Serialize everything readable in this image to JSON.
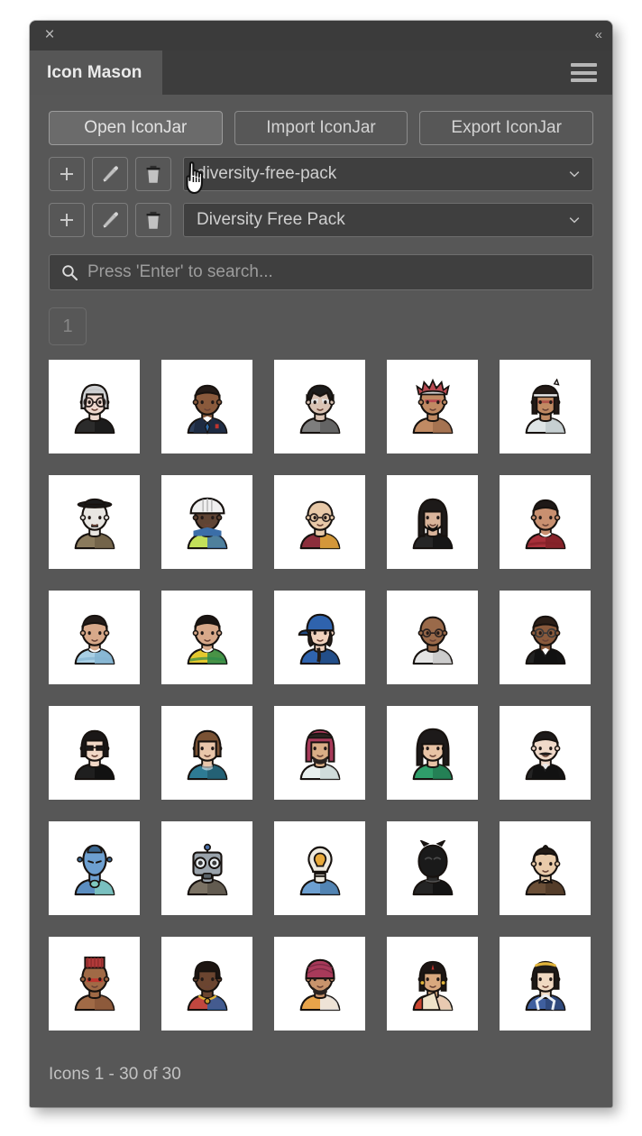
{
  "window": {
    "close_label": "×",
    "collapse_label": "«",
    "tab_label": "Icon Mason",
    "menu_icon": "hamburger-icon"
  },
  "toolbar": {
    "open_label": "Open IconJar",
    "import_label": "Import IconJar",
    "export_label": "Export IconJar"
  },
  "selectors": [
    {
      "add_label": "+",
      "edit_icon": "pencil-icon",
      "delete_icon": "trash-icon",
      "value": "diversity-free-pack",
      "chevron": "chevron-down-icon"
    },
    {
      "add_label": "+",
      "edit_icon": "pencil-icon",
      "delete_icon": "trash-icon",
      "value": "Diversity Free Pack",
      "chevron": "chevron-down-icon"
    }
  ],
  "search": {
    "icon": "search-icon",
    "value": "",
    "placeholder": "Press 'Enter' to search..."
  },
  "pager": {
    "pages": [
      "1"
    ],
    "current": "1"
  },
  "status": {
    "text": "Icons 1 - 30 of 30"
  },
  "colors": {
    "panel_bg": "#575757",
    "titlebar_bg": "#3b3b3b",
    "tabstrip_bg": "#3d3d3d",
    "tab_active_bg": "#565656",
    "field_bg": "#3f3f3f",
    "border": "#6e6e6e",
    "text": "#d3d3d3",
    "muted_text": "#9c9c9c",
    "cell_bg": "#ffffff"
  },
  "grid": {
    "columns": 5,
    "rows": 6,
    "total": 30,
    "icons": [
      {
        "name": "elderly-woman-glasses-avatar",
        "skin": "#f0d9cf",
        "hair": "#cfd0d2",
        "hair2": "#aeb0b3",
        "shirt": "#2b2b2b",
        "shirt2": "#1a1a1a",
        "type": "glasses-dark"
      },
      {
        "name": "businessman-suit-avatar",
        "skin": "#8a5a3c",
        "hair": "#241b17",
        "hair2": "#120d0b",
        "shirt": "#2e3f5c",
        "shirt2": "#1e2b42",
        "type": "suit-tie"
      },
      {
        "name": "batman-mask-avatar",
        "skin": "#d9c3b4",
        "hair": "#1c1c1c",
        "hair2": "#0e0e0e",
        "shirt": "#7d7d7d",
        "shirt2": "#5f5f5f",
        "type": "cowl"
      },
      {
        "name": "native-american-headdress-avatar",
        "skin": "#c08a63",
        "hair": "#3a2a22",
        "hair2": "#b94a52",
        "shirt": "#c08a63",
        "shirt2": "#a06f4e",
        "type": "headdress"
      },
      {
        "name": "native-american-woman-avatar",
        "skin": "#c08a63",
        "hair": "#241b17",
        "hair2": "#e9e9e9",
        "shirt": "#dfe5e6",
        "shirt2": "#c2cbcd",
        "type": "headband"
      },
      {
        "name": "charlie-chaplin-bowler-hat-avatar",
        "skin": "#e8e6e2",
        "hair": "#1c1c1c",
        "hair2": "#0e0e0e",
        "shirt": "#8a7a5c",
        "shirt2": "#6e6047",
        "type": "bowler"
      },
      {
        "name": "construction-worker-helmet-avatar",
        "skin": "#5f4434",
        "hair": "#efefef",
        "hair2": "#cfcfcf",
        "shirt": "#c3e05a",
        "shirt2": "#3b6ea8",
        "type": "hardhat"
      },
      {
        "name": "monk-bald-glasses-avatar",
        "skin": "#e8c9a8",
        "hair": "#e8c9a8",
        "hair2": "#d3b08c",
        "shirt": "#8c2f3c",
        "shirt2": "#e0a93a",
        "type": "glasses-round"
      },
      {
        "name": "long-hair-beard-musician-avatar",
        "skin": "#d9b49a",
        "hair": "#1d1a19",
        "hair2": "#0f0d0c",
        "shirt": "#262626",
        "shirt2": "#141414",
        "type": "longhair"
      },
      {
        "name": "athlete-red-jersey-avatar",
        "skin": "#c89070",
        "hair": "#1f1917",
        "hair2": "#100d0c",
        "shirt": "#a8303a",
        "shirt2": "#812128",
        "type": "jersey"
      },
      {
        "name": "footballer-light-blue-jersey-avatar",
        "skin": "#d8a98a",
        "hair": "#231c19",
        "hair2": "#120e0c",
        "shirt": "#a9cfe4",
        "shirt2": "#84b4d1",
        "type": "jersey"
      },
      {
        "name": "footballer-yellow-jersey-avatar",
        "skin": "#d8a98a",
        "hair": "#1a1512",
        "hair2": "#0d0a09",
        "shirt": "#e3c82e",
        "shirt2": "#2e8a4a",
        "type": "jersey"
      },
      {
        "name": "woman-blue-cap-avatar",
        "skin": "#f0d2bd",
        "hair": "#241d19",
        "hair2": "#120e0c",
        "shirt": "#2f63ad",
        "shirt2": "#214a82",
        "type": "cap"
      },
      {
        "name": "bald-man-round-glasses-avatar",
        "skin": "#9a6a4a",
        "hair": "#9a6a4a",
        "hair2": "#7d543a",
        "shirt": "#e4e4e4",
        "shirt2": "#c8c8c8",
        "type": "glasses-round"
      },
      {
        "name": "man-glasses-black-suit-avatar",
        "skin": "#8a5a3c",
        "hair": "#2c1f18",
        "hair2": "#160f0c",
        "shirt": "#232323",
        "shirt2": "#111111",
        "type": "suit-glasses"
      },
      {
        "name": "woman-sunglasses-black-top-avatar",
        "skin": "#f2d8c6",
        "hair": "#1a1717",
        "hair2": "#0d0b0b",
        "shirt": "#1f1f1f",
        "shirt2": "#101010",
        "type": "sunglasses"
      },
      {
        "name": "woman-brown-hair-blue-shirt-avatar",
        "skin": "#eac6aa",
        "hair": "#7a5234",
        "hair2": "#5c3c26",
        "shirt": "#2e7b94",
        "shirt2": "#225d70",
        "type": "plain"
      },
      {
        "name": "arab-man-keffiyeh-avatar",
        "skin": "#d9ae86",
        "hair": "#2a2320",
        "hair2": "#a83a5a",
        "shirt": "#e8efee",
        "shirt2": "#cbd8d6",
        "type": "keffiyeh"
      },
      {
        "name": "woman-hijab-green-avatar",
        "skin": "#e8c3a5",
        "hair": "#1d1a1a",
        "hair2": "#0f0d0d",
        "shirt": "#2f9e6a",
        "shirt2": "#227a51",
        "type": "hijab"
      },
      {
        "name": "man-mustache-dark-suit-avatar",
        "skin": "#f0d9c9",
        "hair": "#1d1a1a",
        "hair2": "#0f0d0d",
        "shirt": "#242424",
        "shirt2": "#121212",
        "type": "mustache"
      },
      {
        "name": "blue-alien-avatar",
        "skin": "#6d9fd0",
        "hair": "#4e7fae",
        "hair2": "#3a6690",
        "shirt": "#5b8dc0",
        "shirt2": "#7fc9c0",
        "type": "alien"
      },
      {
        "name": "robot-avatar",
        "skin": "#9aa3ab",
        "hair": "#7a838b",
        "hair2": "#5a6369",
        "shirt": "#7b7264",
        "shirt2": "#5e574c",
        "type": "robot"
      },
      {
        "name": "lightbulb-head-avatar",
        "skin": "#eeeadf",
        "hair": "#e8a93a",
        "hair2": "#c98c26",
        "shirt": "#6d9fd0",
        "shirt2": "#4e7fae",
        "type": "bulb"
      },
      {
        "name": "black-panther-mask-avatar",
        "skin": "#2a2a2a",
        "hair": "#1a1a1a",
        "hair2": "#0d0d0d",
        "shirt": "#242424",
        "shirt2": "#121212",
        "type": "panther"
      },
      {
        "name": "samurai-topknot-avatar",
        "skin": "#e9cbaa",
        "hair": "#241c16",
        "hair2": "#120e0b",
        "shirt": "#6b4f37",
        "shirt2": "#503a28",
        "type": "topknot"
      },
      {
        "name": "african-woman-headwrap-avatar",
        "skin": "#a06a46",
        "hair": "#b23a3a",
        "hair2": "#8e2c2c",
        "shirt": "#a06a46",
        "shirt2": "#8a573a",
        "type": "headwrap"
      },
      {
        "name": "african-woman-beaded-necklace-avatar",
        "skin": "#6b4530",
        "hair": "#1d1512",
        "hair2": "#0f0a09",
        "shirt": "#c1473f",
        "shirt2": "#2e5f9e",
        "type": "beads"
      },
      {
        "name": "sikh-man-turban-avatar",
        "skin": "#c8936c",
        "hair": "#2a2320",
        "hair2": "#a83a5a",
        "shirt": "#e8a44a",
        "shirt2": "#efefef",
        "type": "turban"
      },
      {
        "name": "indian-woman-saree-avatar",
        "skin": "#d9a87e",
        "hair": "#1d1614",
        "hair2": "#0f0b0a",
        "shirt": "#c9442f",
        "shirt2": "#efe2c8",
        "type": "saree"
      },
      {
        "name": "japanese-woman-kimono-avatar",
        "skin": "#f0d9c2",
        "hair": "#1d1a18",
        "hair2": "#e0b33a",
        "shirt": "#3f5f9e",
        "shirt2": "#2e4778",
        "type": "kimono"
      }
    ]
  }
}
